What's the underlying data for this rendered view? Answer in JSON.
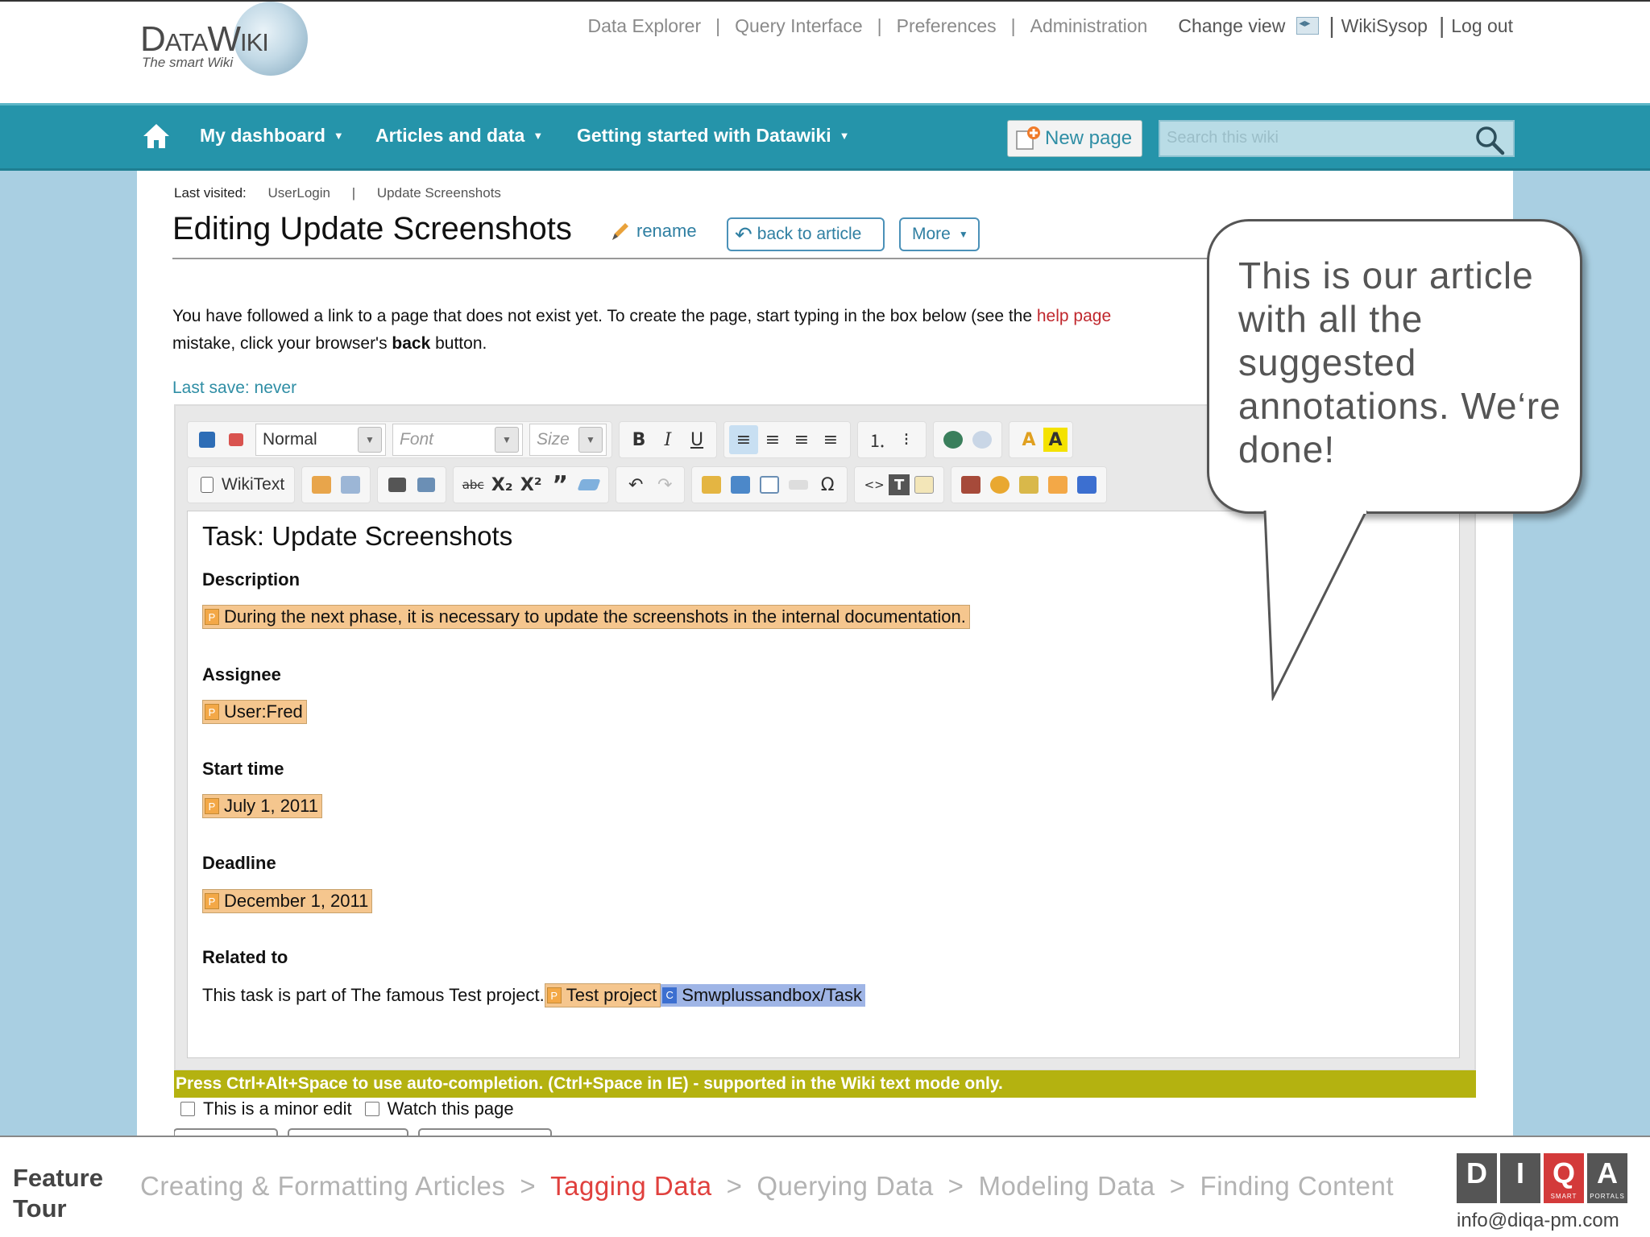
{
  "logo": {
    "word": "DataWiki",
    "tagline": "The smart Wiki"
  },
  "top_links": {
    "data_explorer": "Data Explorer",
    "query_interface": "Query Interface",
    "preferences": "Preferences",
    "administration": "Administration",
    "change_view": "Change view",
    "user": "WikiSysop",
    "logout": "Log out"
  },
  "nav": {
    "dashboard": "My dashboard",
    "articles": "Articles and data",
    "getting_started": "Getting started with Datawiki",
    "new_page": "New page",
    "search_placeholder": "Search this wiki"
  },
  "last_visited": {
    "label": "Last visited:",
    "items": [
      "UserLogin",
      "Update Screenshots"
    ]
  },
  "page": {
    "title": "Editing Update Screenshots",
    "rename": "rename",
    "back": "back to article",
    "more": "More",
    "notice_1": "You have followed a link to a page that does not exist yet. To create the page, start typing in the box below (see the ",
    "notice_link": "help page",
    "notice_2": "mistake, click your browser's ",
    "notice_bold": "back",
    "notice_3": " button.",
    "last_save": "Last save: never"
  },
  "toolbar": {
    "format": "Normal",
    "font": "Font",
    "size": "Size",
    "wikitext": "WikiText",
    "bold": "B",
    "italic": "I",
    "underline": "U",
    "strike": "abc",
    "sub": "X₂",
    "sup": "X²",
    "quote": "”",
    "omega": "Ω",
    "source": "<>",
    "text_t": "T"
  },
  "content": {
    "heading": "Task: Update Screenshots",
    "description_label": "Description",
    "description": "During the next phase, it is necessary to update the screenshots in the internal documentation.",
    "assignee_label": "Assignee",
    "assignee": "User:Fred",
    "start_label": "Start time",
    "start": "July 1, 2011",
    "deadline_label": "Deadline",
    "deadline": "December 1, 2011",
    "related_label": "Related to",
    "related_text": "This task is part of The famous Test project.",
    "related_annotation": "Test project",
    "category": "Smwplussandbox/Task",
    "badge_p": "P",
    "badge_c": "C"
  },
  "hint": "Press Ctrl+Alt+Space to use auto-completion. (Ctrl+Space in IE) - supported in the Wiki text mode only.",
  "checks": {
    "minor": "This is a minor edit",
    "watch": "Watch this page"
  },
  "callout": "This is our article with all the suggested annotations. We‘re done!",
  "footer": {
    "label_1": "Feature",
    "label_2": "Tour",
    "crumbs": [
      "Creating & Formatting Articles",
      "Tagging Data",
      "Querying Data",
      "Modeling Data",
      "Finding Content"
    ],
    "active_index": 1,
    "email": "info@diqa-pm.com",
    "diqa_letters": [
      "D",
      "I",
      "Q",
      "A"
    ],
    "diqa_small_1": "SMART",
    "diqa_small_2": "PORTALS"
  },
  "colors": {
    "nav": "#2594aa",
    "active_crumb": "#e0403d",
    "annotation": "#f5c68e",
    "category": "#9fb5e6",
    "hint_bar": "#b4b210"
  }
}
